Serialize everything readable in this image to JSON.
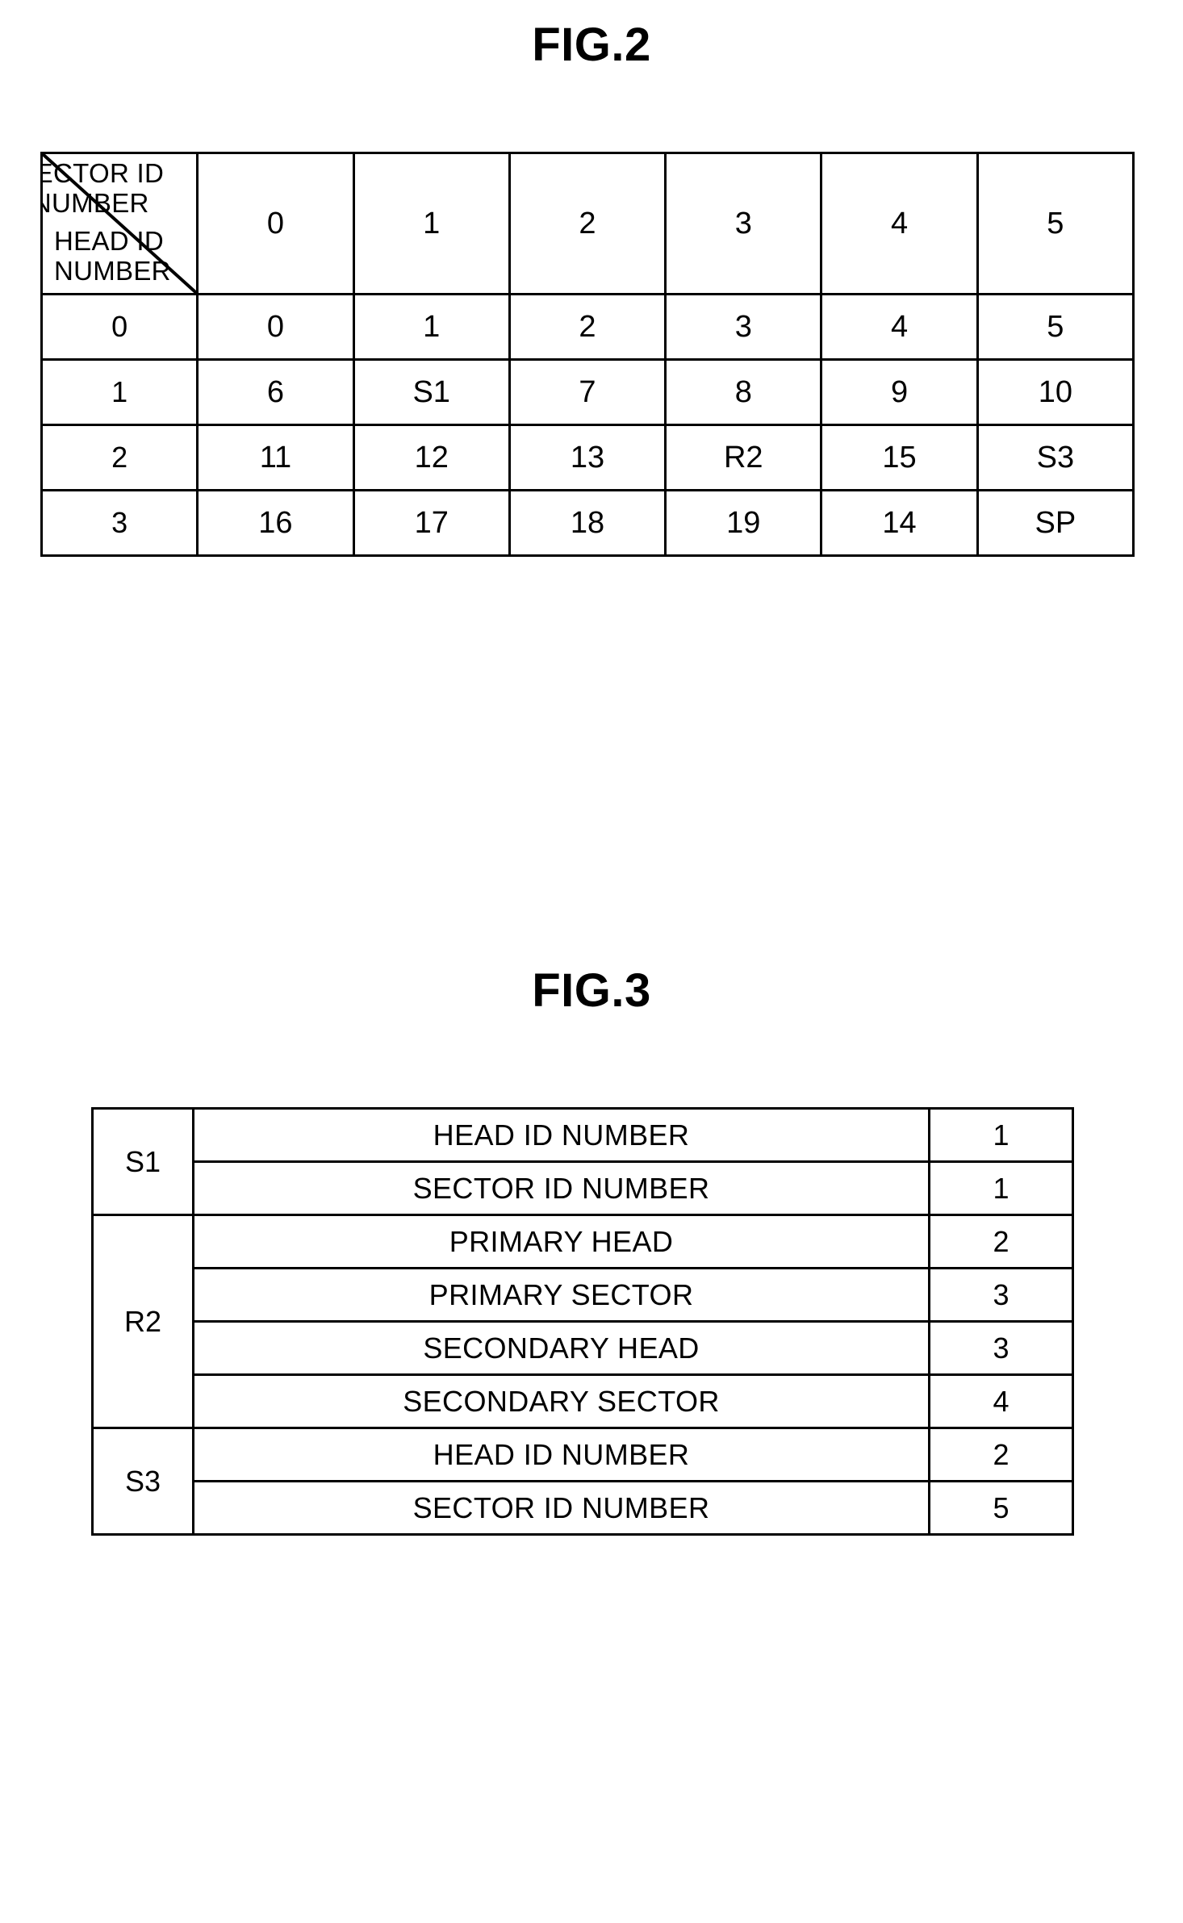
{
  "figures": {
    "fig2": {
      "title": "FIG.2",
      "corner": {
        "column_axis_label": "SECTOR ID\nNUMBER",
        "column_axis_label_line1": "SECTOR ID",
        "column_axis_label_line2": "NUMBER",
        "row_axis_label_line1": "HEAD ID",
        "row_axis_label_line2": "NUMBER"
      },
      "column_headers": [
        "0",
        "1",
        "2",
        "3",
        "4",
        "5"
      ],
      "row_labels": [
        "0",
        "1",
        "2",
        "3"
      ],
      "rows": [
        {
          "label": "0",
          "cells": [
            "0",
            "1",
            "2",
            "3",
            "4",
            "5"
          ]
        },
        {
          "label": "1",
          "cells": [
            "6",
            "S1",
            "7",
            "8",
            "9",
            "10"
          ]
        },
        {
          "label": "2",
          "cells": [
            "11",
            "12",
            "13",
            "R2",
            "15",
            "S3"
          ]
        },
        {
          "label": "3",
          "cells": [
            "16",
            "17",
            "18",
            "19",
            "14",
            "SP"
          ]
        }
      ]
    },
    "fig3": {
      "title": "FIG.3",
      "groups": [
        {
          "name": "S1",
          "fields": [
            {
              "name": "HEAD ID NUMBER",
              "value": "1"
            },
            {
              "name": "SECTOR ID NUMBER",
              "value": "1"
            }
          ]
        },
        {
          "name": "R2",
          "fields": [
            {
              "name": "PRIMARY HEAD",
              "value": "2"
            },
            {
              "name": "PRIMARY SECTOR",
              "value": "3"
            },
            {
              "name": "SECONDARY HEAD",
              "value": "3"
            },
            {
              "name": "SECONDARY SECTOR",
              "value": "4"
            }
          ]
        },
        {
          "name": "S3",
          "fields": [
            {
              "name": "HEAD ID NUMBER",
              "value": "2"
            },
            {
              "name": "SECTOR ID NUMBER",
              "value": "5"
            }
          ]
        }
      ]
    }
  },
  "colors": {
    "ink": "#000000",
    "paper": "#ffffff"
  }
}
